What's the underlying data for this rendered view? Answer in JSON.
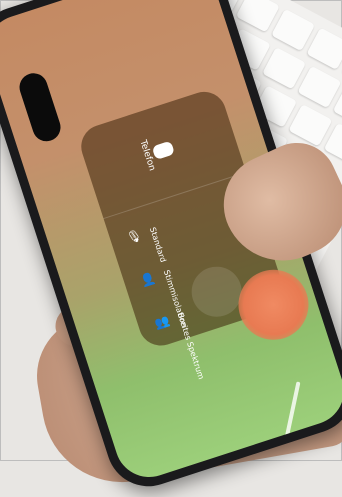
{
  "hint_text": "Breites Spektrum ist derzeit nicht verfügbar",
  "panel": {
    "title": "Telefon",
    "options": [
      {
        "label": "Standard",
        "icon": "mic-icon",
        "selected": true
      },
      {
        "label": "Stimmisolation",
        "icon": "person-wave-icon",
        "selected": false
      },
      {
        "label": "Breites Spektrum",
        "icon": "people-wave-icon",
        "selected": false
      }
    ]
  },
  "check_mark": "✓"
}
